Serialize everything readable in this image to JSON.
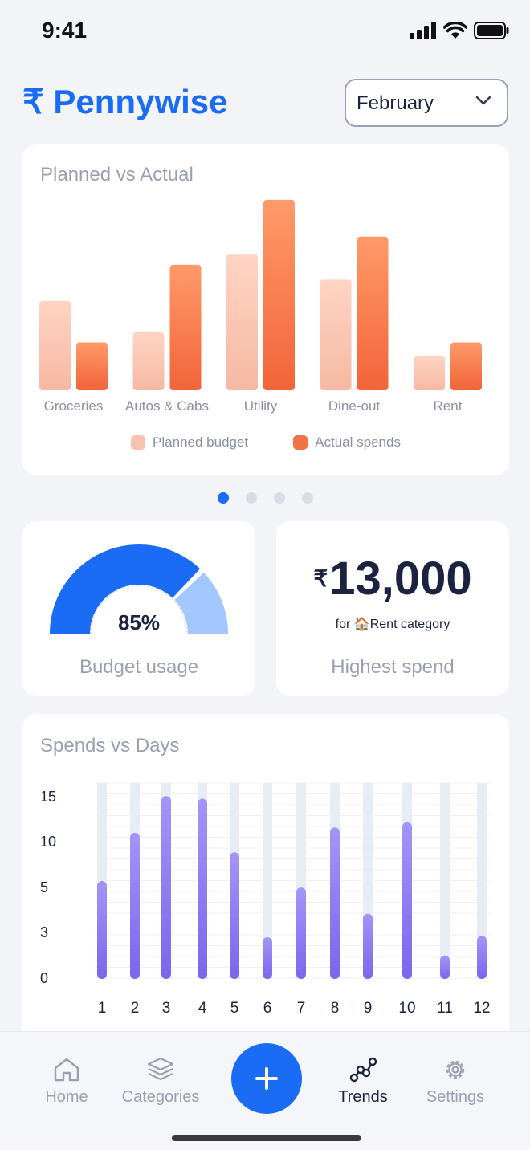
{
  "status_bar": {
    "time": "9:41"
  },
  "header": {
    "brand_symbol": "₹",
    "brand_name": "Pennywise",
    "month": "February"
  },
  "carousel": {
    "count": 4,
    "active_index": 0
  },
  "planned_vs_actual": {
    "title": "Planned vs Actual",
    "legend": {
      "planned": "Planned budget",
      "actual": "Actual spends"
    },
    "colors": {
      "planned_top": "#FFD4C4",
      "planned_bottom": "#F6B9A3",
      "actual_top": "#FF9A68",
      "actual_bottom": "#F2643A"
    }
  },
  "budget_usage": {
    "value": "85%",
    "fraction": 0.85,
    "caption": "Budget usage",
    "colors": {
      "used": "#1A6CF5",
      "remaining": "#A3C8FF"
    }
  },
  "highest_spend": {
    "currency": "₹",
    "amount": "13,000",
    "prefix": "for",
    "emoji": "🏠",
    "category": "Rent category",
    "caption": "Highest spend"
  },
  "spends_vs_days": {
    "title": "Spends vs Days"
  },
  "tabs": [
    {
      "label": "Home",
      "icon": "home-icon"
    },
    {
      "label": "Categories",
      "icon": "layers-icon"
    },
    {
      "label": "Trends",
      "icon": "trends-icon"
    },
    {
      "label": "Settings",
      "icon": "gear-icon"
    }
  ],
  "fab": {
    "icon": "plus-icon"
  },
  "chart_data": [
    {
      "type": "bar",
      "title": "Planned vs Actual",
      "categories": [
        "Groceries",
        "Autos & Cabs",
        "Utility",
        "Dine-out",
        "Rent"
      ],
      "series": [
        {
          "name": "Planned budget",
          "values": [
            114,
            74,
            174,
            141,
            44
          ]
        },
        {
          "name": "Actual spends",
          "values": [
            61,
            160,
            243,
            196,
            61
          ]
        }
      ],
      "ylim": [
        0,
        250
      ],
      "grid": false,
      "legend": "bottom-center"
    },
    {
      "type": "bar",
      "title": "Spends vs Days",
      "categories": [
        "1",
        "2",
        "3",
        "4",
        "5",
        "6",
        "7",
        "8",
        "9",
        "10",
        "11",
        "12"
      ],
      "values": [
        7.5,
        11.2,
        14,
        13.8,
        9.7,
        3.2,
        7,
        11.6,
        5,
        12,
        1.8,
        3.3
      ],
      "yticks": [
        "0",
        "3",
        "5",
        "10",
        "15"
      ],
      "ylim": [
        0,
        15
      ],
      "grid": true
    }
  ]
}
